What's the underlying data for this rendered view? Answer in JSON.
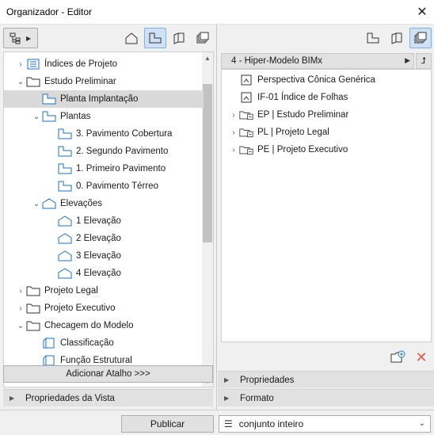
{
  "window": {
    "title": "Organizador - Editor"
  },
  "left": {
    "tree": [
      {
        "label": "Índices de Projeto",
        "chev": "›",
        "icon": "index"
      },
      {
        "label": "Estudo Preliminar",
        "chev": "⌄",
        "icon": "folder"
      },
      {
        "label": "Planta Implantação",
        "chev": "",
        "icon": "plan",
        "selected": true
      },
      {
        "label": "Plantas",
        "chev": "⌄",
        "icon": "plan"
      },
      {
        "label": "3. Pavimento Cobertura",
        "chev": "",
        "icon": "plan"
      },
      {
        "label": "2. Segundo Pavimento",
        "chev": "",
        "icon": "plan"
      },
      {
        "label": "1. Primeiro Pavimento",
        "chev": "",
        "icon": "plan"
      },
      {
        "label": "0. Pavimento Térreo",
        "chev": "",
        "icon": "plan"
      },
      {
        "label": "Elevações",
        "chev": "⌄",
        "icon": "elev"
      },
      {
        "label": "1 Elevação",
        "chev": "",
        "icon": "elev"
      },
      {
        "label": "2 Elevação",
        "chev": "",
        "icon": "elev"
      },
      {
        "label": "3 Elevação",
        "chev": "",
        "icon": "elev"
      },
      {
        "label": "4 Elevação",
        "chev": "",
        "icon": "elev"
      },
      {
        "label": "Projeto Legal",
        "chev": "›",
        "icon": "folder"
      },
      {
        "label": "Projeto Executivo",
        "chev": "›",
        "icon": "folder"
      },
      {
        "label": "Checagem do Modelo",
        "chev": "⌄",
        "icon": "folder"
      },
      {
        "label": "Classificação",
        "chev": "",
        "icon": "3d"
      },
      {
        "label": "Função Estrutural",
        "chev": "",
        "icon": "3d"
      }
    ],
    "add_shortcut": "Adicionar Atalho >>>",
    "view_properties": "Propriedades da Vista"
  },
  "right": {
    "header": "4 - Hiper-Modelo BIMx",
    "items": [
      {
        "label": "Perspectiva Cônica Genérica",
        "chev": "",
        "icon": "persp"
      },
      {
        "label": "IF-01 Índice de Folhas",
        "chev": "",
        "icon": "persp"
      },
      {
        "label": "EP | Estudo Preliminar",
        "chev": "›",
        "icon": "set"
      },
      {
        "label": "PL | Projeto Legal",
        "chev": "›",
        "icon": "set"
      },
      {
        "label": "PE | Projeto Executivo",
        "chev": "›",
        "icon": "set"
      }
    ],
    "properties": "Propriedades",
    "format": "Formato"
  },
  "footer": {
    "publish": "Publicar",
    "scope": "conjunto inteiro"
  },
  "colors": {
    "accent": "#cfe2f5",
    "icon_blue": "#1a73c8",
    "delete": "#e05a4f"
  }
}
